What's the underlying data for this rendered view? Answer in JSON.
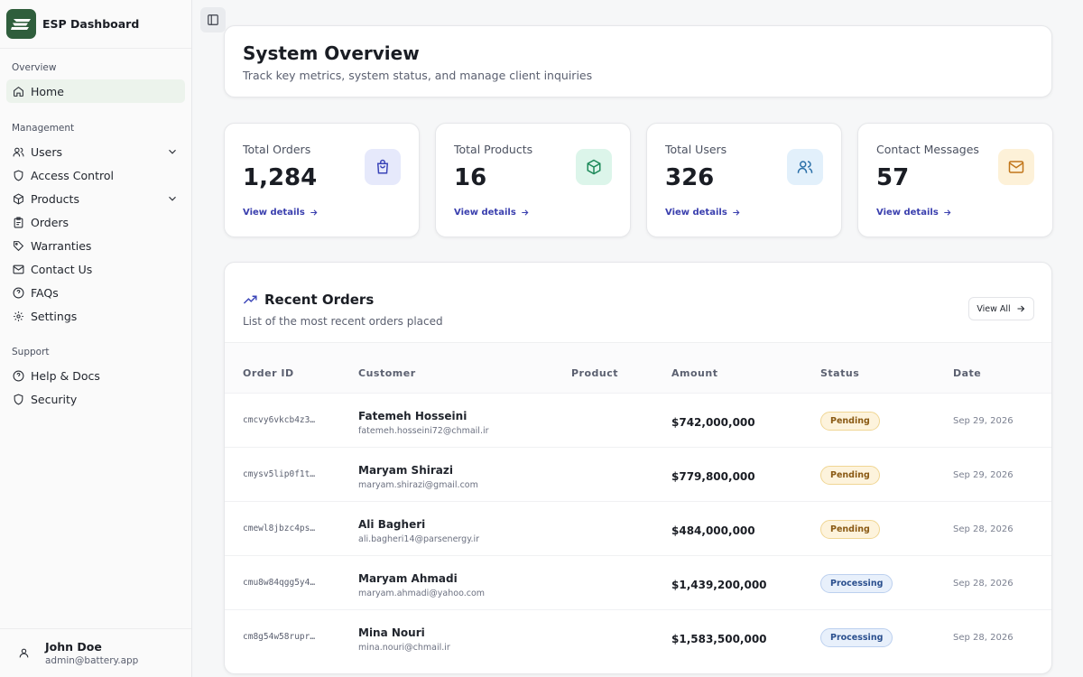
{
  "brand": {
    "title": "ESP Dashboard",
    "logo_color": "#2f5e3c"
  },
  "sidebar": {
    "sections": {
      "overview": "Overview",
      "management": "Management",
      "support": "Support"
    },
    "items": [
      {
        "label": "Home",
        "icon": "home-icon",
        "active": true
      },
      {
        "label": "Users",
        "icon": "users-icon",
        "has_submenu": true
      },
      {
        "label": "Access Control",
        "icon": "shield-icon"
      },
      {
        "label": "Products",
        "icon": "box-icon",
        "has_submenu": true
      },
      {
        "label": "Orders",
        "icon": "clipboard-icon"
      },
      {
        "label": "Warranties",
        "icon": "tag-icon"
      },
      {
        "label": "Contact Us",
        "icon": "mail-icon"
      },
      {
        "label": "FAQs",
        "icon": "help-circle-icon"
      },
      {
        "label": "Settings",
        "icon": "gear-icon"
      },
      {
        "label": "Help & Docs",
        "icon": "help-circle-icon"
      },
      {
        "label": "Security",
        "icon": "shield-icon"
      }
    ],
    "user": {
      "name": "John Doe",
      "email": "admin@battery.app"
    }
  },
  "overview": {
    "title": "System Overview",
    "subtitle": "Track key metrics, system status, and manage client inquiries"
  },
  "stats": [
    {
      "label": "Total Orders",
      "value": "1,284",
      "link": "View details",
      "icon": "shopping-bag-icon",
      "icon_bg": "#e6e9fb",
      "icon_color": "#3b45b8"
    },
    {
      "label": "Total Products",
      "value": "16",
      "link": "View details",
      "icon": "package-icon",
      "icon_bg": "#dcf5ea",
      "icon_color": "#1e8a5a"
    },
    {
      "label": "Total Users",
      "value": "326",
      "link": "View details",
      "icon": "users-icon",
      "icon_bg": "#e2f0fb",
      "icon_color": "#2a6fa8"
    },
    {
      "label": "Contact Messages",
      "value": "57",
      "link": "View details",
      "icon": "mail-icon",
      "icon_bg": "#fdf1d8",
      "icon_color": "#c2761a"
    }
  ],
  "recent_orders": {
    "title": "Recent Orders",
    "subtitle": "List of the most recent orders placed",
    "view_all": "View All",
    "columns": [
      "Order ID",
      "Customer",
      "Product",
      "Amount",
      "Status",
      "Date"
    ],
    "rows": [
      {
        "id": "cmcvy6vkcb4z3…",
        "name": "Fatemeh Hosseini",
        "email": "fatemeh.hosseini72@chmail.ir",
        "product": "",
        "amount": "$742,000,000",
        "status": "Pending",
        "date": "Sep 29, 2026"
      },
      {
        "id": "cmysv5lip0f1t…",
        "name": "Maryam Shirazi",
        "email": "maryam.shirazi@gmail.com",
        "product": "",
        "amount": "$779,800,000",
        "status": "Pending",
        "date": "Sep 29, 2026"
      },
      {
        "id": "cmewl8jbzc4ps…",
        "name": "Ali Bagheri",
        "email": "ali.bagheri14@parsenergy.ir",
        "product": "",
        "amount": "$484,000,000",
        "status": "Pending",
        "date": "Sep 28, 2026"
      },
      {
        "id": "cmu8w84qgg5y4…",
        "name": "Maryam Ahmadi",
        "email": "maryam.ahmadi@yahoo.com",
        "product": "",
        "amount": "$1,439,200,000",
        "status": "Processing",
        "date": "Sep 28, 2026"
      },
      {
        "id": "cm8g54w58rupr…",
        "name": "Mina Nouri",
        "email": "mina.nouri@chmail.ir",
        "product": "",
        "amount": "$1,583,500,000",
        "status": "Processing",
        "date": "Sep 28, 2026"
      }
    ]
  }
}
